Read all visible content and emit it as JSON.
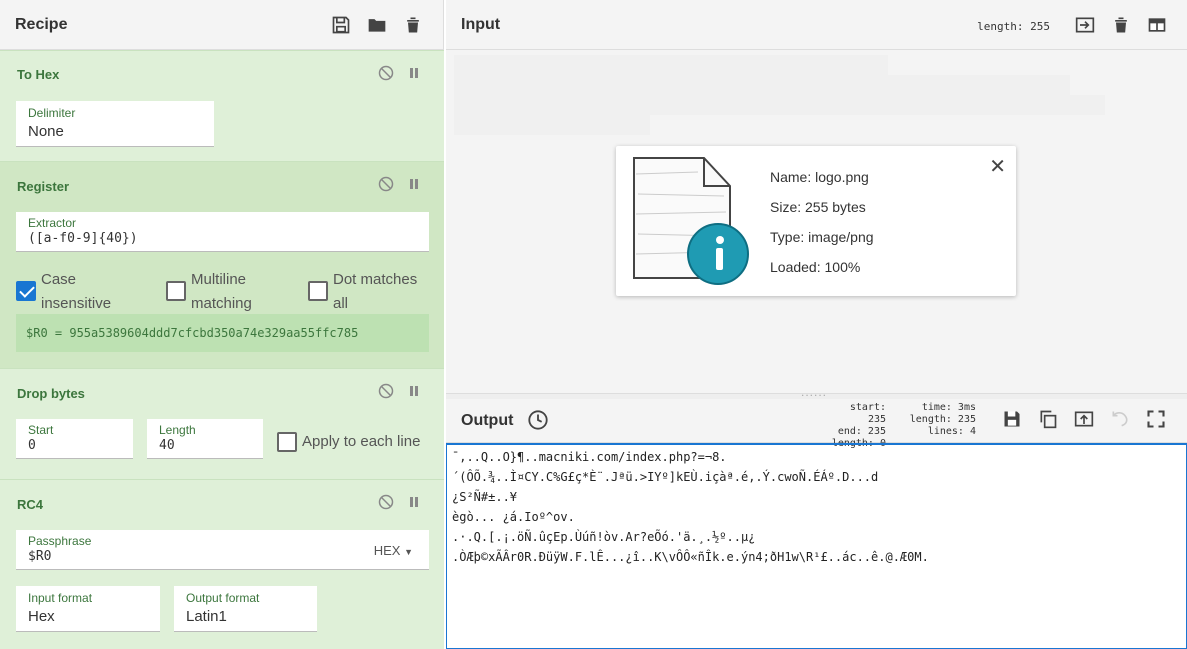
{
  "recipe": {
    "title": "Recipe",
    "ops": [
      {
        "name": "To Hex",
        "fields": [
          {
            "label": "Delimiter",
            "value": "None"
          }
        ]
      },
      {
        "name": "Register",
        "extractor_label": "Extractor",
        "extractor_value": "([a-f0-9]{40})",
        "checks": [
          {
            "label": "Case insensitive",
            "checked": true
          },
          {
            "label": "Multiline matching",
            "checked": false
          },
          {
            "label": "Dot matches all",
            "checked": false
          }
        ],
        "output": "$R0 = 955a5389604ddd7cfcbd350a74e329aa55ffc785"
      },
      {
        "name": "Drop bytes",
        "start_label": "Start",
        "start_value": "0",
        "length_label": "Length",
        "length_value": "40",
        "apply_label": "Apply to each line"
      },
      {
        "name": "RC4",
        "passphrase_label": "Passphrase",
        "passphrase_value": "$R0",
        "passphrase_format": "HEX",
        "input_format_label": "Input format",
        "input_format_value": "Hex",
        "output_format_label": "Output format",
        "output_format_value": "Latin1"
      }
    ]
  },
  "input": {
    "title": "Input",
    "length_text": "length: 255",
    "file": {
      "name": "Name: logo.png",
      "size": "Size: 255 bytes",
      "type": "Type: image/png",
      "loaded": "Loaded: 100%"
    }
  },
  "output": {
    "title": "Output",
    "stats_left": [
      "start: 235",
      "end: 235",
      "length:   0"
    ],
    "stats_right": [
      "time:   3ms",
      "length:  235",
      "lines:    4"
    ],
    "lines": [
      "¯,..Q..O}¶..macniki.com/index.php?=¬8.",
      "´(ÔÕ.¾..Ì¤CY.C%G£ç*È¨.Jªü.>IYº]kEÙ.içàª.é,.Ý.cwoÑ.ÉÁº.D...d",
      "¿S²Ñ#±..¥",
      "ègò... ¿á.Ioº^ov.",
      ".·.Q.[.¡.öÑ.ûçEp.Ùúñ!òv.Ar?eÕó.'ä.¸.½º..µ¿",
      ".ÒÆþ©xÃÂr0R.ÐüÿW.F.lÊ...¿î..K\\vÔÔ«ñÎk.e.ýn4;ðH1w\\R¹£..ác..ê.@.Æ0M."
    ]
  },
  "colors": {
    "accent": "#1976d2",
    "op_bg": "#dff0d8",
    "op_title": "#3c763d"
  }
}
